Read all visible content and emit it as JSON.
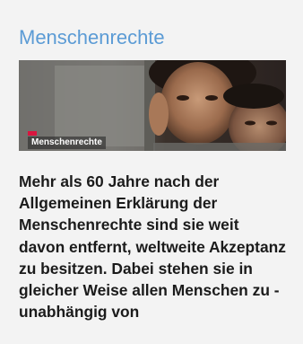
{
  "card": {
    "title": "Menschenrechte",
    "image_caption": "Menschenrechte",
    "teaser": "Mehr als 60 Jahre nach der Allgemeinen Erklärung der Menschenrechte sind sie weit davon entfernt, weltweite Akzeptanz zu besitzen. Dabei stehen sie in gleicher Weise allen Menschen zu - unabhängig von",
    "colors": {
      "title": "#5b9bd5",
      "background": "#f3f3f3",
      "tag": "#d9153f",
      "text": "#1b1b1b"
    }
  }
}
